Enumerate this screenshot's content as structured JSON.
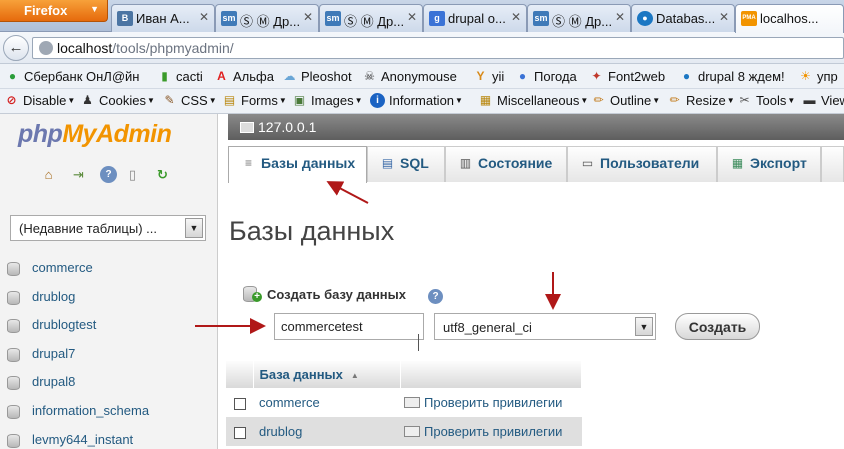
{
  "browser": {
    "app_button": "Firefox",
    "tabs": [
      {
        "label": "Иван А...",
        "favicon": "vk-icon",
        "favicon_text": "B",
        "favicon_color": "#4c75a3"
      },
      {
        "label": "Ⓢ Ⓜ Др...",
        "favicon": "sm-icon",
        "favicon_text": "sm",
        "favicon_color": "#3f7ab8"
      },
      {
        "label": "Ⓢ Ⓜ Др...",
        "favicon": "sm-icon",
        "favicon_text": "sm",
        "favicon_color": "#3f7ab8"
      },
      {
        "label": "drupal o...",
        "favicon": "google-icon",
        "favicon_text": "g",
        "favicon_color": "#3b73d6"
      },
      {
        "label": "Ⓢ Ⓜ Др...",
        "favicon": "sm-icon",
        "favicon_text": "sm",
        "favicon_color": "#3f7ab8"
      },
      {
        "label": "Databas...",
        "favicon": "drupal-icon",
        "favicon_text": "●",
        "favicon_color": "#1b77c3"
      },
      {
        "label": "localhos...",
        "favicon": "pma-icon",
        "favicon_text": "PMA",
        "favicon_color": "#f29400"
      }
    ],
    "url_host": "localhost",
    "url_path": "/tools/phpmyadmin/"
  },
  "bookmarks": [
    {
      "label": "Сбербанк ОнЛ@йн",
      "icon": "sberbank-icon",
      "glyph": "●",
      "color": "#2a9d3a"
    },
    {
      "label": "cacti",
      "icon": "cacti-icon",
      "glyph": "▮",
      "color": "#3a9a2a"
    },
    {
      "label": "Альфа",
      "icon": "alfa-icon",
      "glyph": "A",
      "color": "#e02020"
    },
    {
      "label": "Pleoshot",
      "icon": "pleoshot-icon",
      "glyph": "☁",
      "color": "#6aa6d6"
    },
    {
      "label": "Anonymouse",
      "icon": "anonymouse-icon",
      "glyph": "☠",
      "color": "#333333"
    },
    {
      "label": "yii",
      "icon": "yii-icon",
      "glyph": "Y",
      "color": "#d88a1a"
    },
    {
      "label": "Погода",
      "icon": "weather-icon",
      "glyph": "●",
      "color": "#3b73d6"
    },
    {
      "label": "Font2web",
      "icon": "font2web-icon",
      "glyph": "✦",
      "color": "#c0392b"
    },
    {
      "label": "drupal 8 ждем!",
      "icon": "drupal-icon",
      "glyph": "●",
      "color": "#1b77c3"
    },
    {
      "label": "упр",
      "icon": "sun-icon",
      "glyph": "☀",
      "color": "#f29400"
    }
  ],
  "devtoolbar": [
    {
      "label": "Disable",
      "icon": "disable-icon",
      "glyph": "⊘",
      "color": "#d32020"
    },
    {
      "label": "Cookies",
      "icon": "cookies-icon",
      "glyph": "♟",
      "color": "#333333"
    },
    {
      "label": "CSS",
      "icon": "css-icon",
      "glyph": "✎",
      "color": "#8a5a2a"
    },
    {
      "label": "Forms",
      "icon": "forms-icon",
      "glyph": "▤",
      "color": "#b8860b"
    },
    {
      "label": "Images",
      "icon": "images-icon",
      "glyph": "▣",
      "color": "#4a7a3a"
    },
    {
      "label": "Information",
      "icon": "information-icon",
      "glyph": "i",
      "color": "#1b63c3"
    },
    {
      "label": "Miscellaneous",
      "icon": "miscellaneous-icon",
      "glyph": "▦",
      "color": "#b8860b"
    },
    {
      "label": "Outline",
      "icon": "outline-icon",
      "glyph": "✏",
      "color": "#c27a1a"
    },
    {
      "label": "Resize",
      "icon": "resize-icon",
      "glyph": "✏",
      "color": "#c27a1a"
    },
    {
      "label": "Tools",
      "icon": "tools-icon",
      "glyph": "✂",
      "color": "#555555"
    },
    {
      "label": "View",
      "icon": "view-icon",
      "glyph": "▬",
      "color": "#333333"
    }
  ],
  "pma": {
    "logo": {
      "php": "php",
      "my": "My",
      "admin": "Admin"
    },
    "recent_tables": "(Недавние таблицы) ...",
    "databases": [
      "commerce",
      "drublog",
      "drublogtest",
      "drupal7",
      "drupal8",
      "information_schema",
      "levmy644_instant"
    ],
    "server": "127.0.0.1",
    "tabs": [
      {
        "label": "Базы данных",
        "icon": "databases-icon",
        "glyph": "≡",
        "active": true
      },
      {
        "label": "SQL",
        "icon": "sql-icon",
        "glyph": "▤",
        "active": false
      },
      {
        "label": "Состояние",
        "icon": "status-icon",
        "glyph": "▥",
        "active": false
      },
      {
        "label": "Пользователи",
        "icon": "users-icon",
        "glyph": "▭",
        "active": false
      },
      {
        "label": "Экспорт",
        "icon": "export-icon",
        "glyph": "▦",
        "active": false
      }
    ],
    "page_title": "Базы данных",
    "create": {
      "label": "Создать базу данных",
      "db_name_value": "commercetest",
      "collation": "utf8_general_ci",
      "button": "Создать"
    },
    "table": {
      "header": "База данных",
      "rows": [
        {
          "name": "commerce",
          "action": "Проверить привилегии"
        },
        {
          "name": "drublog",
          "action": "Проверить привилегии"
        }
      ]
    }
  },
  "colors": {
    "link": "#235a81",
    "annotation_arrow": "#b01818",
    "firefox_orange": "#e66a0c",
    "pma_orange": "#f29400",
    "pma_blue": "#6c78af"
  }
}
